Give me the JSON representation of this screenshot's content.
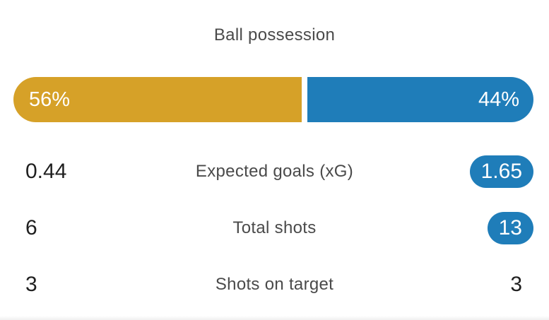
{
  "colors": {
    "home": "#D6A128",
    "away": "#1F7DB9"
  },
  "possession": {
    "title": "Ball possession",
    "home_label": "56%",
    "away_label": "44%",
    "home_value": 56,
    "away_value": 44
  },
  "stats": [
    {
      "home": "0.44",
      "label": "Expected goals (xG)",
      "away": "1.65",
      "away_highlighted": true
    },
    {
      "home": "6",
      "label": "Total shots",
      "away": "13",
      "away_highlighted": true
    },
    {
      "home": "3",
      "label": "Shots on target",
      "away": "3",
      "away_highlighted": false
    }
  ]
}
